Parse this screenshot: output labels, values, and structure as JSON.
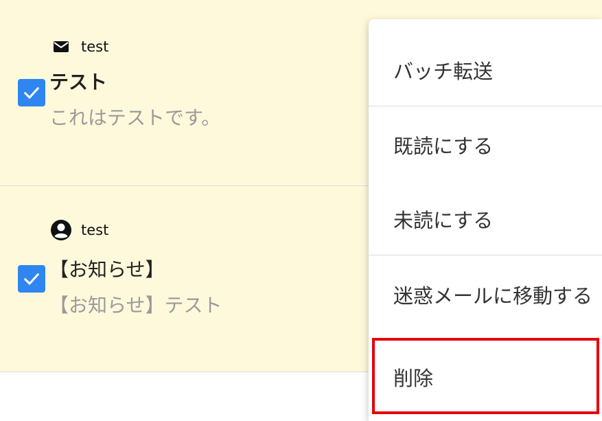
{
  "messages": [
    {
      "sender_icon": "mail-icon",
      "sender": "test",
      "subject": "テスト",
      "preview": "これはテストです。",
      "checked": true
    },
    {
      "sender_icon": "account-circle-icon",
      "sender": "test",
      "subject": "【お知らせ】",
      "preview": "【お知らせ】テスト",
      "checked": true
    }
  ],
  "context_menu": {
    "items": [
      {
        "label": "バッチ転送"
      },
      {
        "label": "既読にする"
      },
      {
        "label": "未読にする"
      },
      {
        "label": "迷惑メールに移動する"
      },
      {
        "label": "削除",
        "highlighted": true
      }
    ]
  },
  "colors": {
    "row_background": "#fff9dc",
    "checkbox": "#2f86f0",
    "highlight": "#e5000b"
  }
}
